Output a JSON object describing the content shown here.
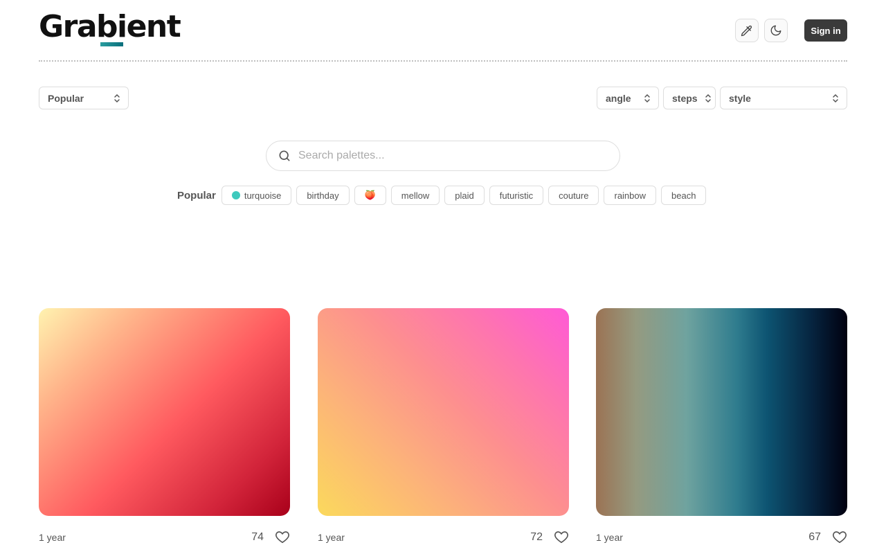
{
  "header": {
    "logo": "Grabient",
    "sign_in": "Sign in"
  },
  "controls": {
    "sort": "Popular",
    "angle": "angle",
    "steps": "steps",
    "style": "style"
  },
  "search": {
    "placeholder": "Search palettes..."
  },
  "tags": {
    "label": "Popular",
    "items": [
      "turquoise",
      "birthday",
      "🍑",
      "mellow",
      "plaid",
      "futuristic",
      "couture",
      "rainbow",
      "beach"
    ]
  },
  "cards": [
    {
      "age": "1 year",
      "likes": "74"
    },
    {
      "age": "1 year",
      "likes": "72"
    },
    {
      "age": "1 year",
      "likes": "67"
    }
  ],
  "colors": {
    "signin_bg": "#3a3a3a",
    "turquoise_dot": "#3ec9bd"
  }
}
